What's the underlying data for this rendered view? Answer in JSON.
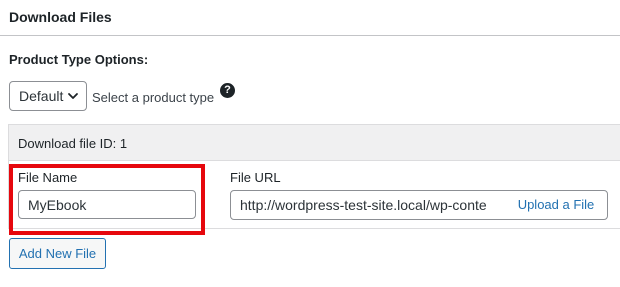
{
  "panel": {
    "title": "Download Files"
  },
  "product_type": {
    "label": "Product Type Options:",
    "selected": "Default",
    "hint": "Select a product type",
    "help_glyph": "?"
  },
  "file": {
    "header": "Download file ID: 1",
    "name_label": "File Name",
    "name_value": "MyEbook",
    "url_label": "File URL",
    "url_value": "http://wordpress-test-site.local/wp-conte",
    "upload_label": "Upload a File"
  },
  "actions": {
    "add_label": "Add New File"
  },
  "colors": {
    "highlight": "#e6070d",
    "link": "#2271b1",
    "header_bg": "#f0f0f1"
  }
}
